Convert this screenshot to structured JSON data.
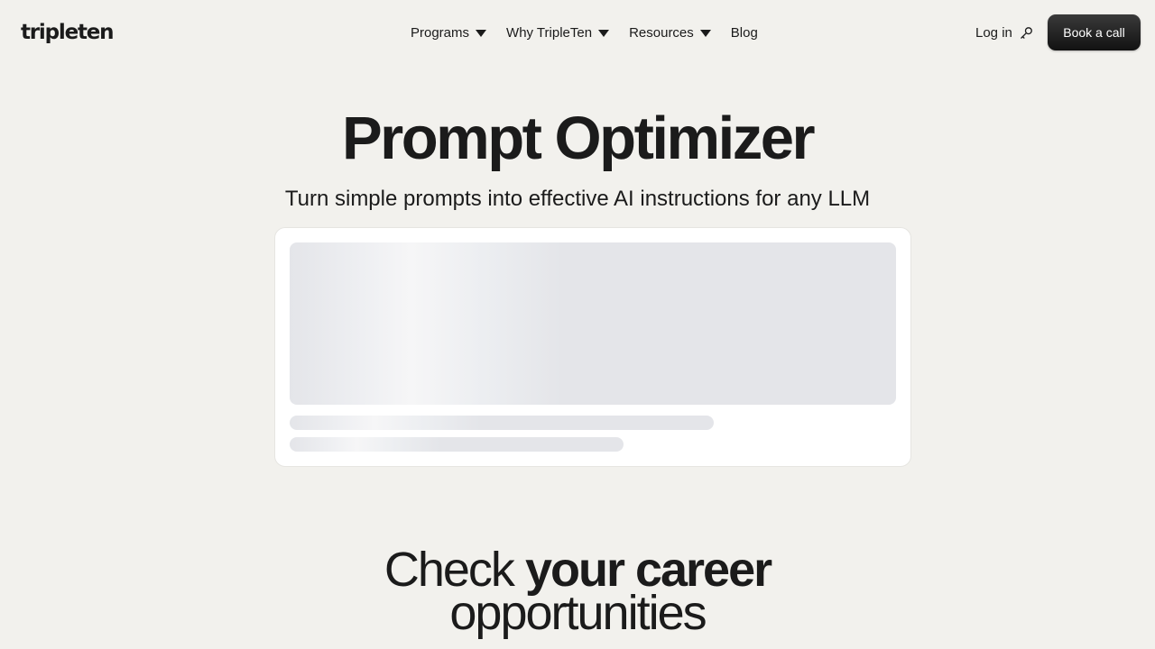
{
  "header": {
    "logo_text": "tripleten",
    "nav": [
      {
        "label": "Programs",
        "dropdown": true
      },
      {
        "label": "Why TripleTen",
        "dropdown": true
      },
      {
        "label": "Resources",
        "dropdown": true
      },
      {
        "label": "Blog",
        "dropdown": false
      }
    ],
    "login_label": "Log in",
    "login_icon": "key-icon",
    "book_call_label": "Book a call"
  },
  "hero": {
    "title": "Prompt Optimizer",
    "subtitle": "Turn simple prompts into effective AI instructions for any LLM"
  },
  "card": {
    "state": "loading"
  },
  "career": {
    "line1_light": "Check ",
    "line1_bold": "your career",
    "line2": "opportunities"
  },
  "colors": {
    "background": "#f2f1ed",
    "text": "#1b1b1b",
    "button": "#1b1b1b",
    "skeleton": "#e4e5e9"
  }
}
